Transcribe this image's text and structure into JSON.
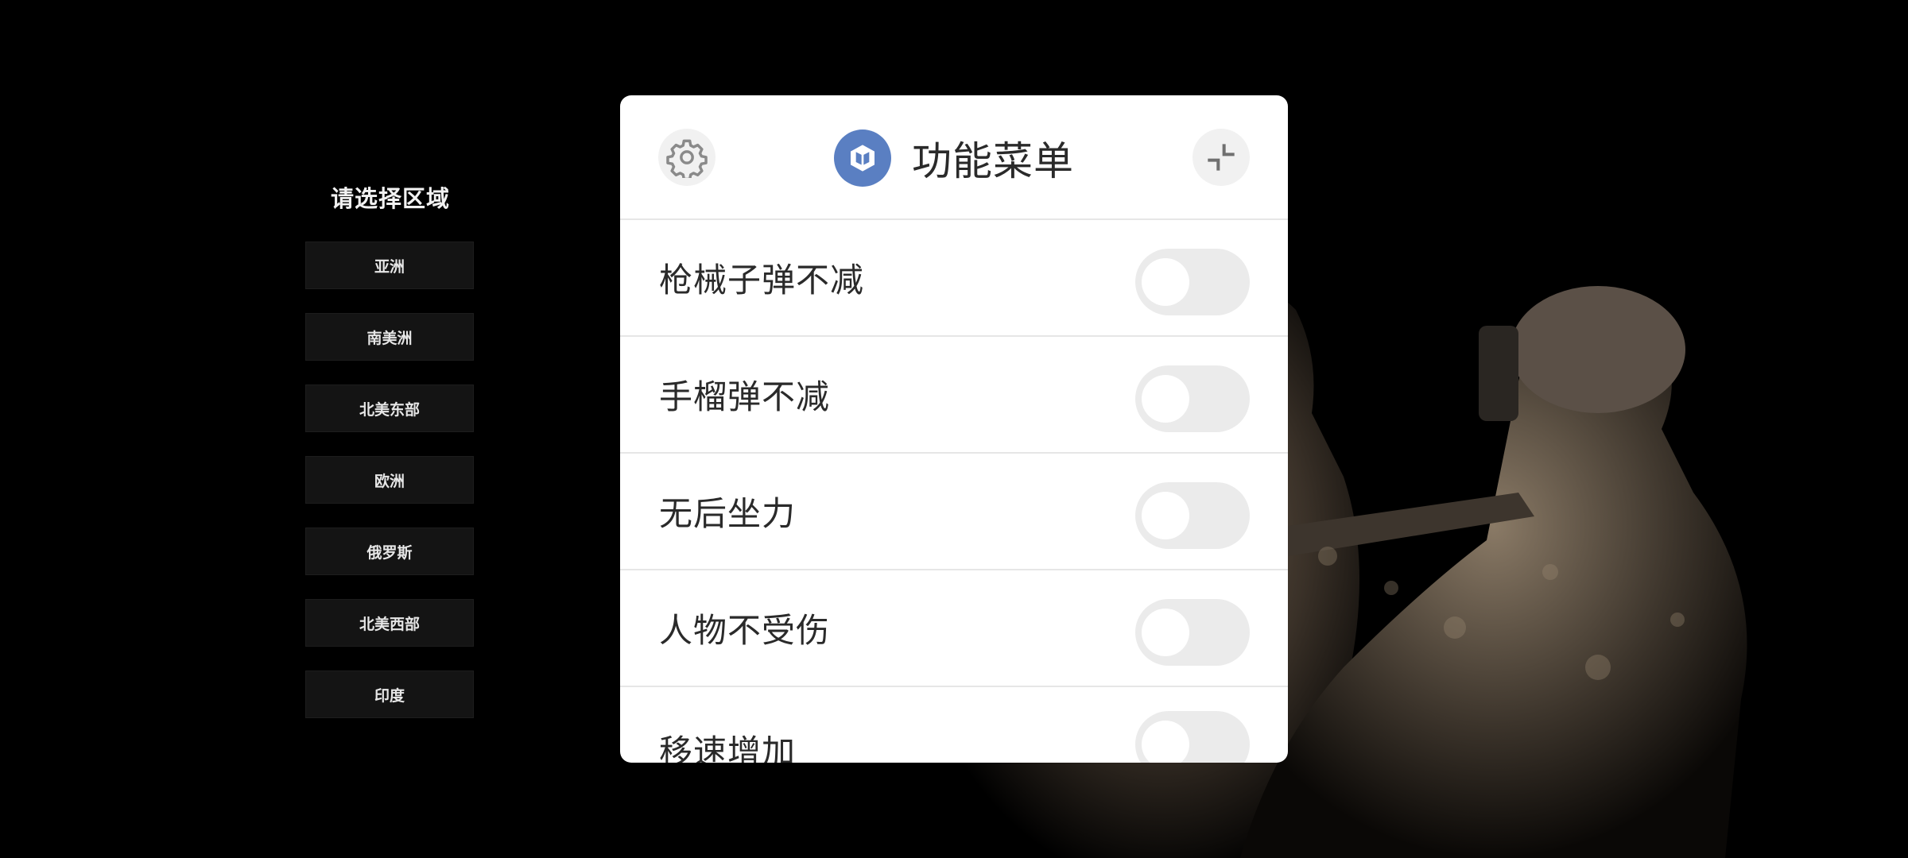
{
  "region_selector": {
    "title": "请选择区域",
    "regions": [
      {
        "label": "亚洲"
      },
      {
        "label": "南美洲"
      },
      {
        "label": "北美东部"
      },
      {
        "label": "欧洲"
      },
      {
        "label": "俄罗斯"
      },
      {
        "label": "北美西部"
      },
      {
        "label": "印度"
      }
    ]
  },
  "menu": {
    "title": "功能菜单",
    "settings_icon": "gear-icon",
    "logo_icon": "cube-logo-icon",
    "minimize_icon": "minimize-icon",
    "accent_color": "#5a7fc2",
    "items": [
      {
        "label": "枪械子弹不减",
        "enabled": false
      },
      {
        "label": "手榴弹不减",
        "enabled": false
      },
      {
        "label": "无后坐力",
        "enabled": false
      },
      {
        "label": "人物不受伤",
        "enabled": false
      },
      {
        "label": "移速增加",
        "enabled": false
      }
    ]
  }
}
